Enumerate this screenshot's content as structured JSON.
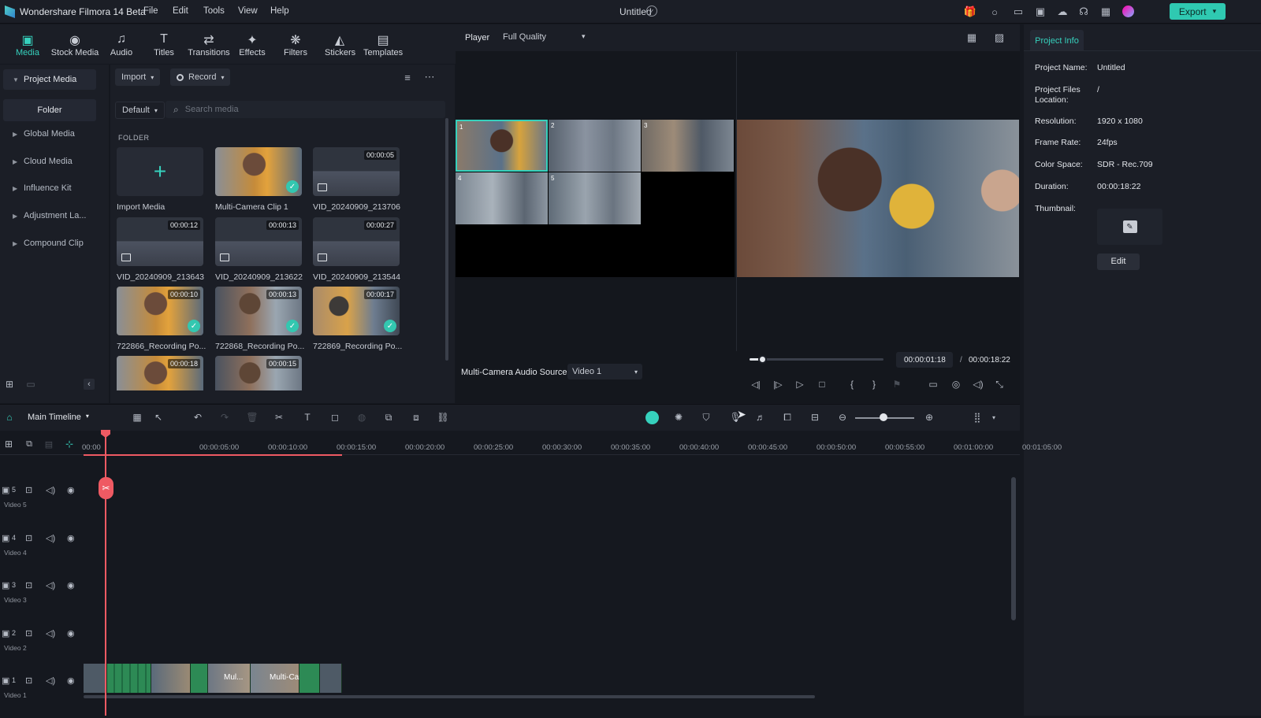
{
  "app": {
    "title": "Wondershare Filmora 14 Beta"
  },
  "menu": [
    "File",
    "Edit",
    "Tools",
    "View",
    "Help"
  ],
  "document_title": "Untitled",
  "export_label": "Export",
  "tools": [
    {
      "label": "Media",
      "icon": "media-icon"
    },
    {
      "label": "Stock Media",
      "icon": "stock-media-icon"
    },
    {
      "label": "Audio",
      "icon": "audio-icon"
    },
    {
      "label": "Titles",
      "icon": "titles-icon"
    },
    {
      "label": "Transitions",
      "icon": "transitions-icon"
    },
    {
      "label": "Effects",
      "icon": "effects-icon"
    },
    {
      "label": "Filters",
      "icon": "filters-icon"
    },
    {
      "label": "Stickers",
      "icon": "stickers-icon"
    },
    {
      "label": "Templates",
      "icon": "templates-icon"
    }
  ],
  "sidebar": {
    "items": [
      "Project Media",
      "Global Media",
      "Cloud Media",
      "Influence Kit",
      "Adjustment La...",
      "Compound Clip"
    ],
    "folder": "Folder"
  },
  "media": {
    "import_label": "Import",
    "record_label": "Record",
    "sort_label": "Default",
    "search_placeholder": "Search media",
    "folder_heading": "FOLDER",
    "cards": [
      {
        "label": "Import Media",
        "duration": ""
      },
      {
        "label": "Multi-Camera Clip 1",
        "duration": ""
      },
      {
        "label": "VID_20240909_213706",
        "duration": "00:00:05"
      },
      {
        "label": "VID_20240909_213643",
        "duration": "00:00:12"
      },
      {
        "label": "VID_20240909_213622",
        "duration": "00:00:13"
      },
      {
        "label": "VID_20240909_213544",
        "duration": "00:00:27"
      },
      {
        "label": "722866_Recording Po...",
        "duration": "00:00:10"
      },
      {
        "label": "722868_Recording Po...",
        "duration": "00:00:13"
      },
      {
        "label": "722869_Recording Po...",
        "duration": "00:00:17"
      },
      {
        "label": "",
        "duration": "00:00:18"
      },
      {
        "label": "",
        "duration": "00:00:15"
      }
    ]
  },
  "player": {
    "label": "Player",
    "quality": "Full Quality",
    "current_time": "00:00:01:18",
    "separator": "/",
    "total_time": "00:00:18:22",
    "audio_source_label": "Multi-Camera Audio Source",
    "audio_source_value": "Video 1",
    "camera_numbers": [
      "1",
      "2",
      "3",
      "4",
      "5"
    ],
    "progress": 0.09
  },
  "project_info": {
    "tab": "Project Info",
    "rows": [
      {
        "key": "Project Name:",
        "value": "Untitled"
      },
      {
        "key": "Project Files Location:",
        "value": "/"
      },
      {
        "key": "Resolution:",
        "value": "1920 x 1080"
      },
      {
        "key": "Frame Rate:",
        "value": "24fps"
      },
      {
        "key": "Color Space:",
        "value": "SDR - Rec.709"
      },
      {
        "key": "Duration:",
        "value": "00:00:18:22"
      },
      {
        "key": "Thumbnail:",
        "value": ""
      }
    ],
    "edit_label": "Edit"
  },
  "timeline": {
    "name": "Main Timeline",
    "ruler": [
      "00:00",
      "00:00:05:00",
      "00:00:10:00",
      "00:00:15:00",
      "00:00:20:00",
      "00:00:25:00",
      "00:00:30:00",
      "00:00:35:00",
      "00:00:40:00",
      "00:00:45:00",
      "00:00:50:00",
      "00:00:55:00",
      "00:01:00:00",
      "00:01:05:00"
    ],
    "tracks": [
      {
        "num": "5",
        "label": "Video 5"
      },
      {
        "num": "4",
        "label": "Video 4"
      },
      {
        "num": "3",
        "label": "Video 3"
      },
      {
        "num": "2",
        "label": "Video 2"
      },
      {
        "num": "1",
        "label": "Video 1"
      }
    ],
    "clip_labels": [
      "Mul...",
      "Multi-Came..."
    ]
  }
}
